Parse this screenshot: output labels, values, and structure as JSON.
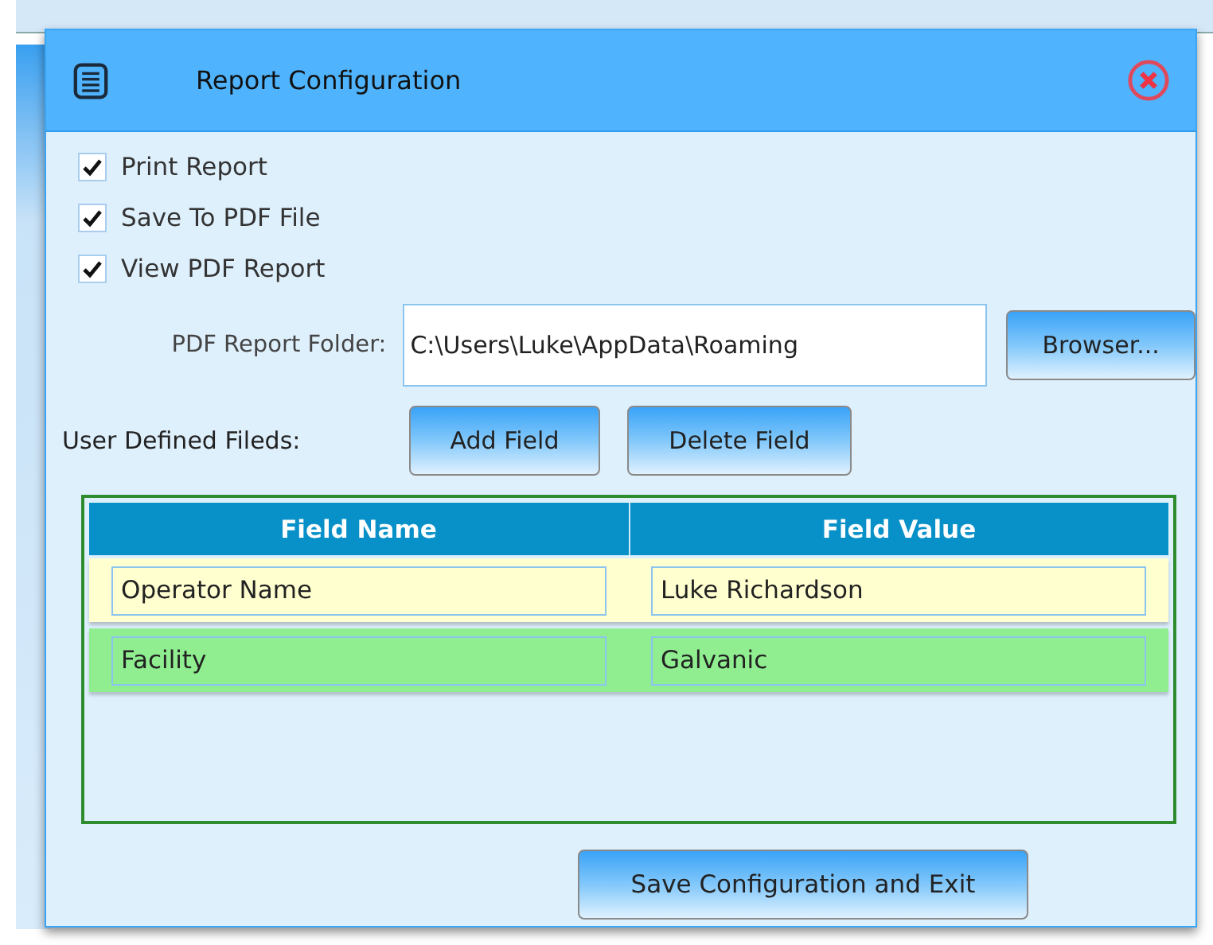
{
  "window": {
    "title": "Report Configuration"
  },
  "options": [
    {
      "label": "Print Report",
      "checked": true
    },
    {
      "label": "Save To PDF File",
      "checked": true
    },
    {
      "label": "View PDF Report",
      "checked": true
    }
  ],
  "folder": {
    "label": "PDF Report Folder:",
    "value": "C:\\Users\\Luke\\AppData\\Roaming",
    "browse_button": "Browser..."
  },
  "user_fields": {
    "label": "User Defined Fileds:",
    "add_button": "Add Field",
    "delete_button": "Delete Field"
  },
  "table": {
    "columns": [
      "Field Name",
      "Field Value"
    ],
    "rows": [
      {
        "cells": [
          "Operator Name",
          "Luke Richardson"
        ],
        "selected": false
      },
      {
        "cells": [
          "Facility",
          "Galvanic"
        ],
        "selected": true
      }
    ]
  },
  "save_button": "Save Configuration and Exit"
}
